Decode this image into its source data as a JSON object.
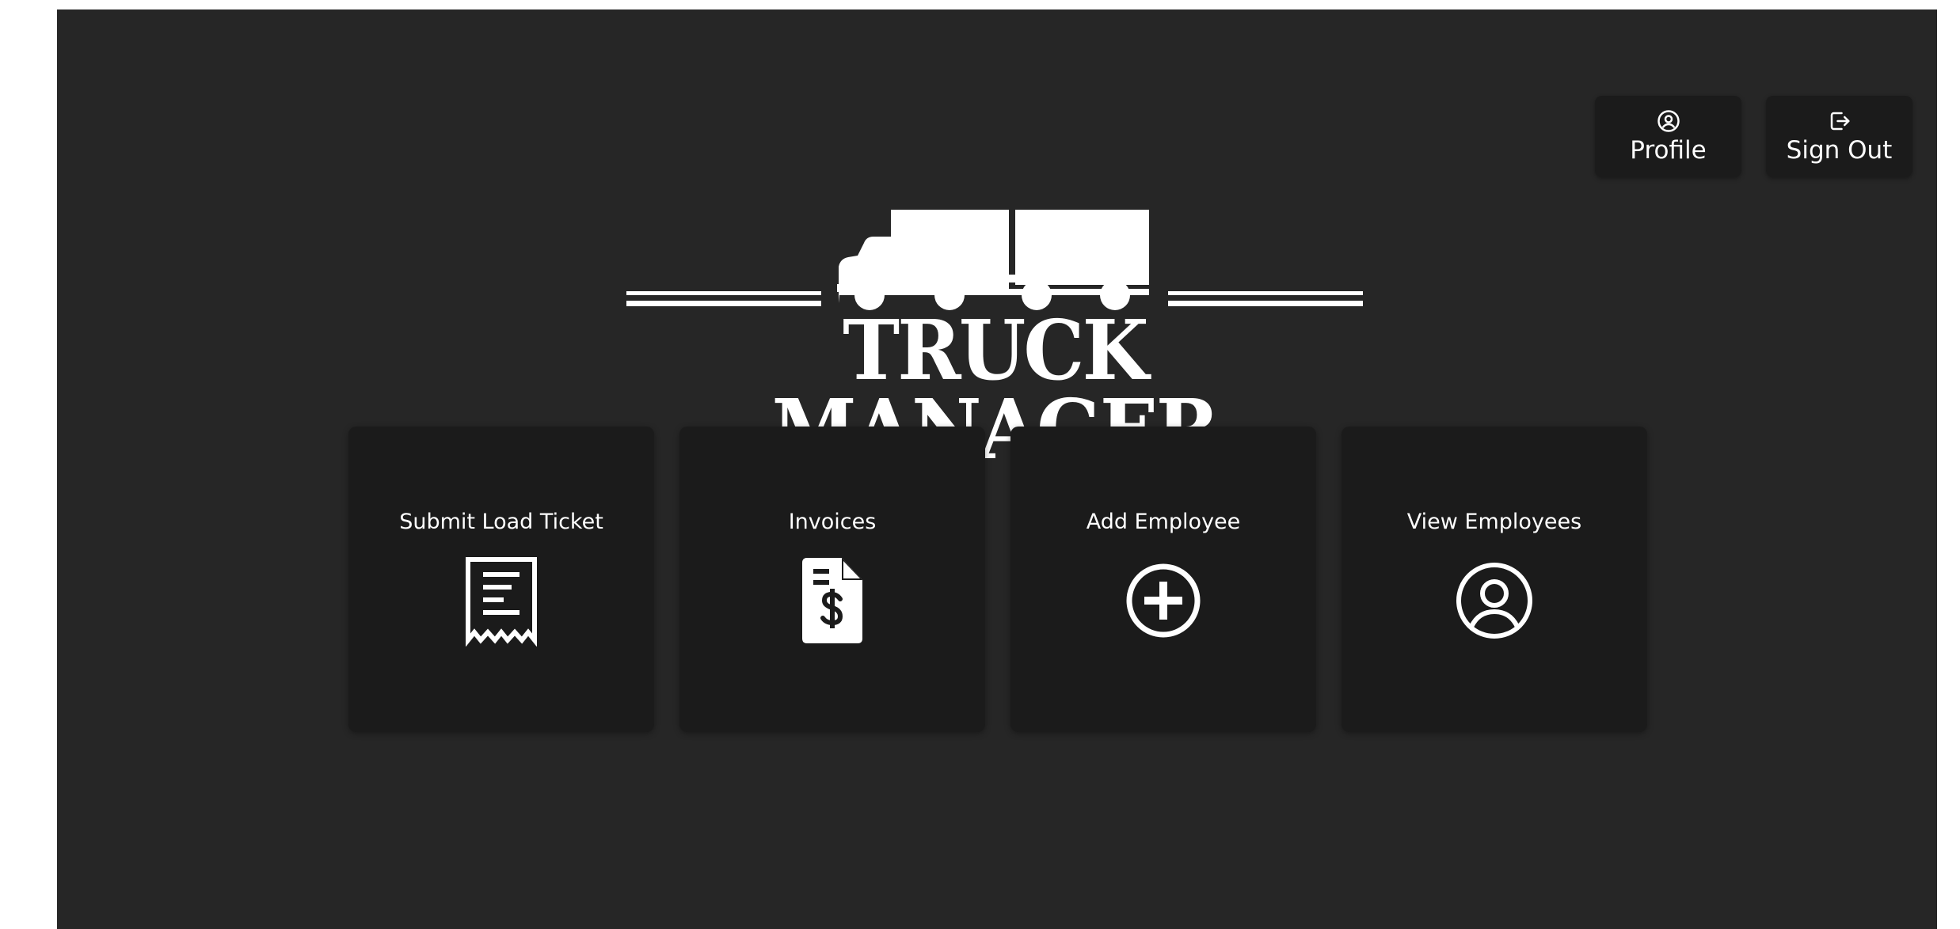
{
  "header": {
    "profile": {
      "label": "Profile",
      "icon": "user-circle-icon"
    },
    "sign_out": {
      "label": "Sign Out",
      "icon": "sign-out-icon"
    }
  },
  "logo": {
    "text": "TRUCK MANAGER",
    "icon": "semi-truck-icon"
  },
  "cards": [
    {
      "label": "Submit Load Ticket",
      "icon": "receipt-icon"
    },
    {
      "label": "Invoices",
      "icon": "invoice-dollar-icon"
    },
    {
      "label": "Add Employee",
      "icon": "plus-circle-icon"
    },
    {
      "label": "View Employees",
      "icon": "user-circle-icon"
    }
  ],
  "colors": {
    "background": "#262626",
    "card": "#1b1b1b",
    "text": "#ffffff"
  }
}
